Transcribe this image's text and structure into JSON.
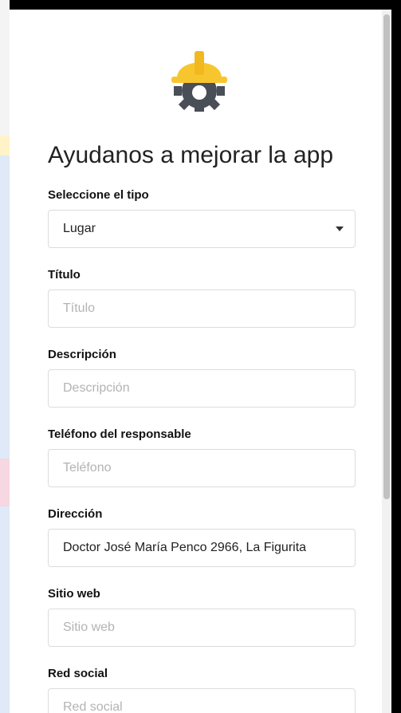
{
  "title": "Ayudanos a mejorar la app",
  "icon": "construction-helmet-gear-icon",
  "colors": {
    "helmet": "#f7c62f",
    "gear": "#4a4e57",
    "border": "#dcdcdc",
    "placeholder": "#b3b3b3"
  },
  "fields": {
    "type": {
      "label": "Seleccione el tipo",
      "value": "Lugar"
    },
    "title": {
      "label": "Título",
      "placeholder": "Título"
    },
    "description": {
      "label": "Descripción",
      "placeholder": "Descripción"
    },
    "phone": {
      "label": "Teléfono del responsable",
      "placeholder": "Teléfono"
    },
    "address": {
      "label": "Dirección",
      "value": "Doctor José María Penco 2966, La Figurita"
    },
    "website": {
      "label": "Sitio web",
      "placeholder": "Sitio web"
    },
    "social": {
      "label": "Red social",
      "placeholder": "Red social"
    }
  }
}
